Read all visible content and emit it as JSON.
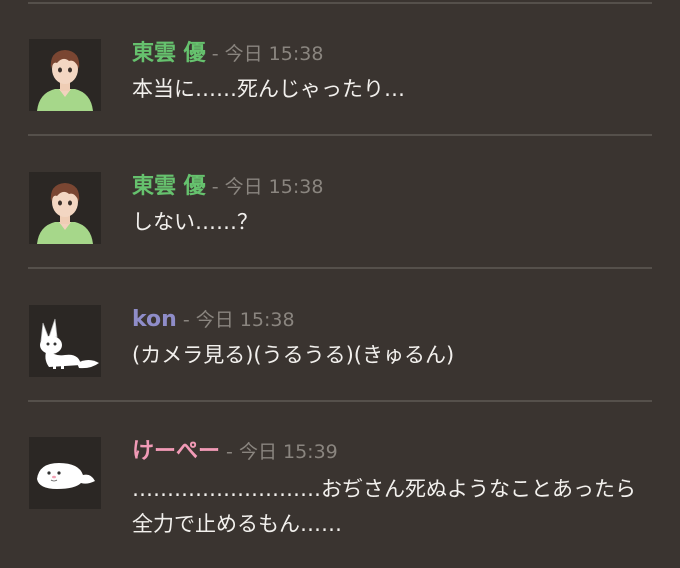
{
  "messages": [
    {
      "name": "東雲 優",
      "name_color": "#66c26e",
      "separator": " - ",
      "time": "今日 15:38",
      "text": "本当に……死んじゃったり…",
      "avatar": "green-shirt-boy-avatar"
    },
    {
      "name": "東雲 優",
      "name_color": "#66c26e",
      "separator": " - ",
      "time": "今日 15:38",
      "text": "しない……？",
      "avatar": "green-shirt-boy-avatar"
    },
    {
      "name": "kon",
      "name_color": "#8f8dc9",
      "separator": " - ",
      "time": "今日 15:38",
      "text": "(カメラ見る)(うるうる)(きゅるん)",
      "avatar": "white-fox-avatar"
    },
    {
      "name": "けーぺー",
      "name_color": "#f19ab6",
      "separator": " - ",
      "time": "今日 15:39",
      "text": "………………………おぢさん死ぬようなことあったら全力で止めるもん……",
      "avatar": "white-seal-avatar"
    }
  ]
}
